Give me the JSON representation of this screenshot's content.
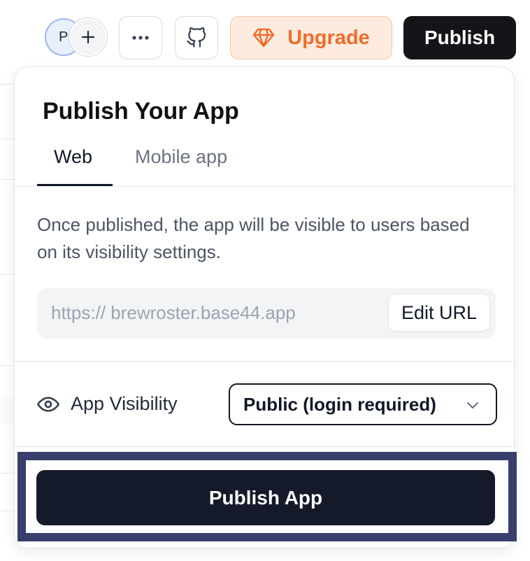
{
  "toolbar": {
    "avatar_initial": "P",
    "add_collaborator_symbol": "+",
    "more_icon": "more-horizontal-icon",
    "github_icon": "github-icon",
    "upgrade_label": "Upgrade",
    "upgrade_icon": "diamond-icon",
    "publish_label": "Publish"
  },
  "dialog": {
    "title": "Publish Your App",
    "tabs": [
      {
        "label": "Web",
        "active": true
      },
      {
        "label": "Mobile app",
        "active": false
      }
    ],
    "description": "Once published, the app will be visible to users based on its visibility settings.",
    "url": {
      "value": "https:// brewroster.base44.app",
      "edit_label": "Edit URL"
    },
    "visibility": {
      "icon": "eye-icon",
      "label": "App Visibility",
      "selected": "Public (login required)"
    },
    "publish_app_label": "Publish App"
  },
  "colors": {
    "primary_dark": "#141518",
    "publish_app_bg": "#141a29",
    "upgrade_text": "#ef6c2b",
    "upgrade_bg": "#fdebe0",
    "focus_ring": "#383f6d"
  }
}
